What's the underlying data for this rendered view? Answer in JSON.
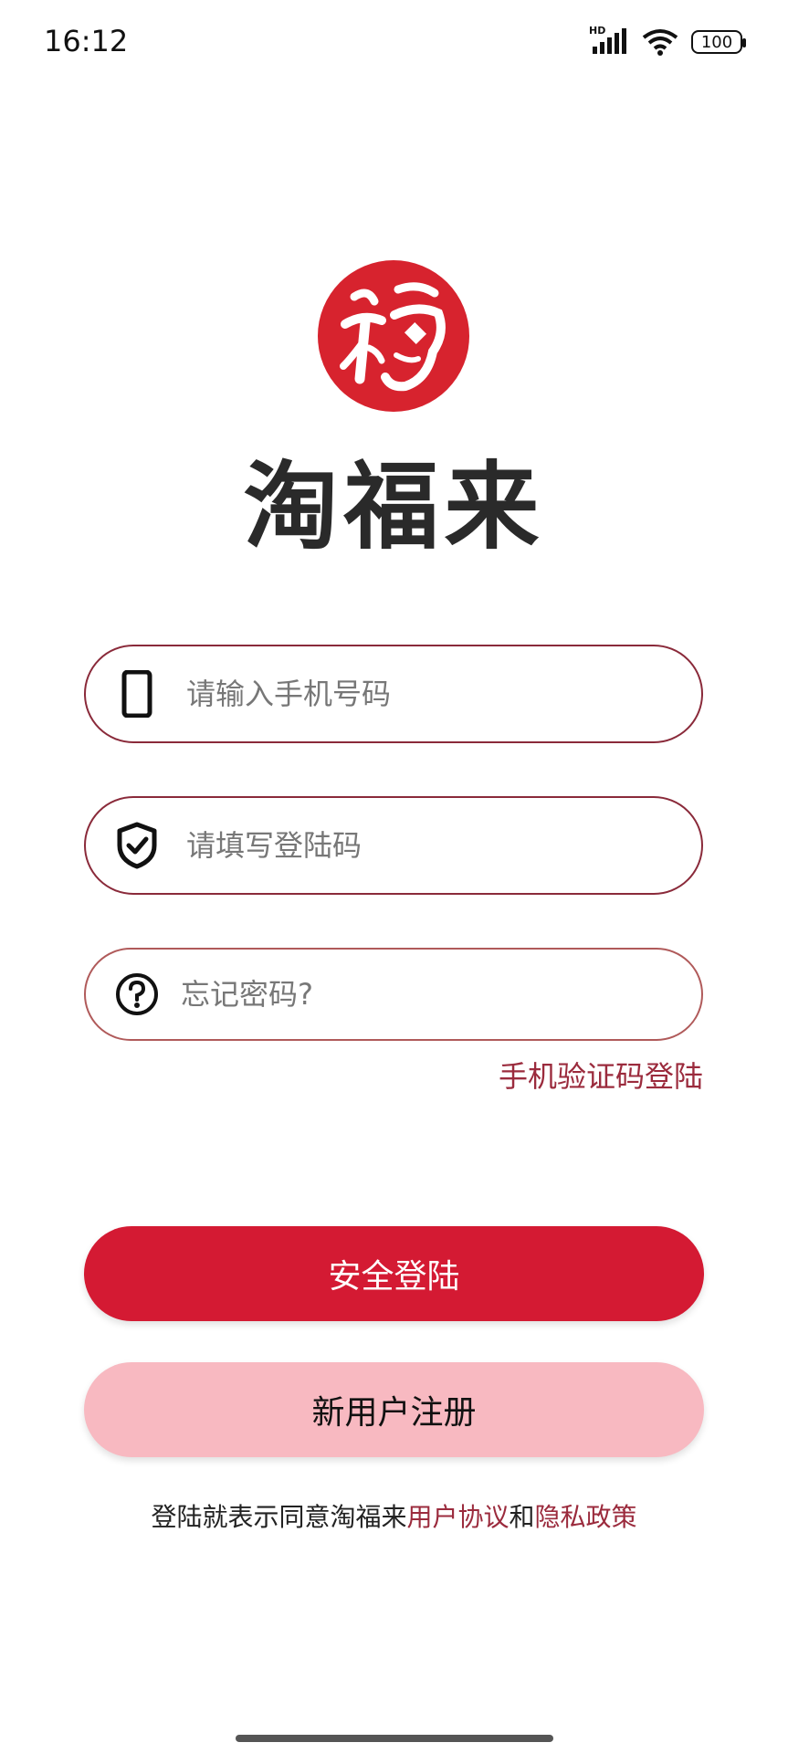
{
  "status_bar": {
    "time": "16:12",
    "network_label": "HD",
    "battery_level": "100",
    "icons": [
      "signal-icon",
      "wifi-icon",
      "battery-icon"
    ]
  },
  "logo": {
    "brand_name": "淘福来",
    "logo_icon": "fu-character-logo",
    "brand_color": "#d7232e"
  },
  "form": {
    "phone": {
      "placeholder": "请输入手机号码",
      "value": "",
      "icon": "phone-icon"
    },
    "login_code": {
      "placeholder": "请填写登陆码",
      "value": "",
      "icon": "shield-check-icon"
    },
    "forgot": {
      "placeholder": "忘记密码?",
      "value": "",
      "icon": "question-circle-icon"
    },
    "sms_login_link": "手机验证码登陆"
  },
  "buttons": {
    "login_label": "安全登陆",
    "register_label": "新用户注册",
    "login_color": "#d41a33",
    "register_color": "#f8b9c1"
  },
  "agreement": {
    "prefix": "登陆就表示同意淘福来",
    "user_agreement": "用户协议",
    "conjunction": "和",
    "privacy_policy": "隐私政策",
    "link_color": "#9b2b3d"
  }
}
